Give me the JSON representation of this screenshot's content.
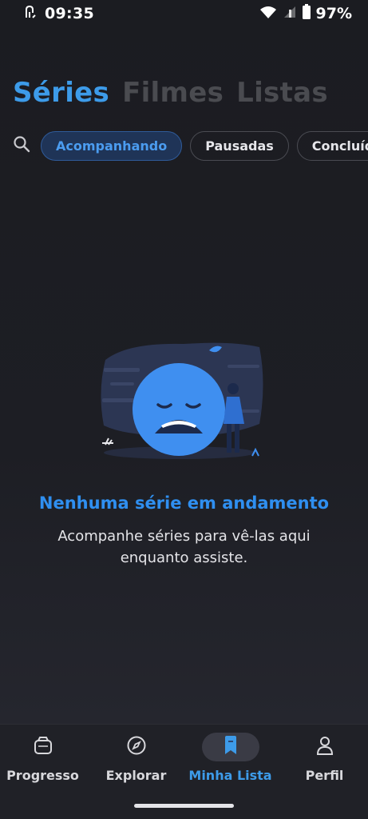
{
  "status_bar": {
    "time": "09:35",
    "battery_percent": "97%",
    "icons": [
      "nfc-icon",
      "wifi-icon",
      "signal-icon",
      "battery-icon"
    ]
  },
  "category_tabs": [
    {
      "label": "Séries",
      "active": true
    },
    {
      "label": "Filmes",
      "active": false
    },
    {
      "label": "Listas",
      "active": false
    }
  ],
  "filters": {
    "search_icon": "search-icon",
    "chips": [
      {
        "label": "Acompanhando",
        "active": true
      },
      {
        "label": "Pausadas",
        "active": false
      },
      {
        "label": "Concluídas",
        "active": false
      }
    ]
  },
  "empty_state": {
    "illustration": "sad-face-illustration",
    "title": "Nenhuma série em andamento",
    "subtitle": "Acompanhe séries para vê-las aqui enquanto assiste."
  },
  "bottom_nav": {
    "items": [
      {
        "label": "Progresso",
        "icon": "tv-icon",
        "active": false
      },
      {
        "label": "Explorar",
        "icon": "compass-icon",
        "active": false
      },
      {
        "label": "Minha Lista",
        "icon": "bookmark-icon",
        "active": true
      },
      {
        "label": "Perfil",
        "icon": "person-icon",
        "active": false
      }
    ]
  },
  "colors": {
    "accent": "#3d9be9",
    "background": "#1b1c21",
    "chip_active_bg": "#1f3457",
    "nav_background": "#202127"
  }
}
